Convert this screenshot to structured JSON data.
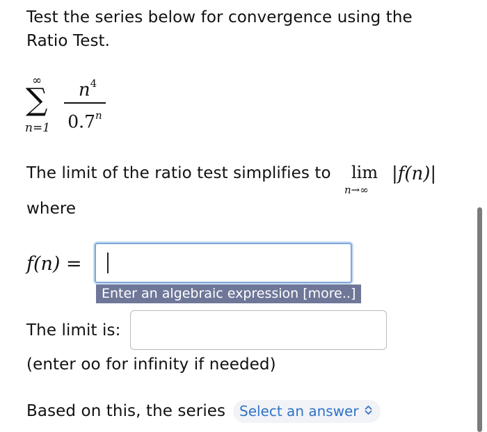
{
  "question": {
    "prompt": "Test the series below for convergence using the Ratio Test."
  },
  "series": {
    "sum_upper": "∞",
    "sum_lower": "n=1",
    "numerator_base": "n",
    "numerator_exp": "4",
    "denominator_base": "0.7",
    "denominator_exp": "n"
  },
  "limit_statement": {
    "text": "The limit of the ratio test simplifies to",
    "lim": "lim",
    "lim_sub": "n→∞",
    "expression": "|f(n)|",
    "where": "where"
  },
  "fn_field": {
    "label": "f(n) =",
    "value": "",
    "hint": "Enter an algebraic expression [more..]"
  },
  "limit_field": {
    "label": "The limit is:",
    "value": "",
    "note": "(enter oo for infinity if needed)"
  },
  "conclusion": {
    "text": "Based on this, the series",
    "select_label": "Select an answer"
  },
  "colors": {
    "accent_blue": "#2f73c8",
    "focus_border": "#7fa7d8",
    "hint_bg": "#6f7799"
  }
}
